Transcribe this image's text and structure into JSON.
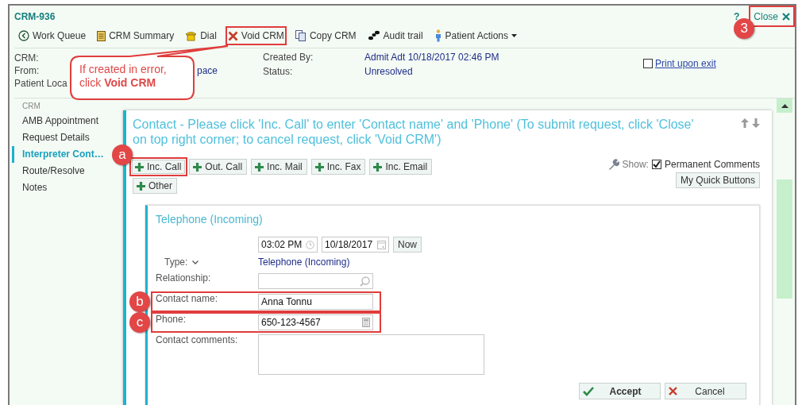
{
  "window": {
    "title": "CRM-936",
    "help": "?",
    "close": {
      "label": "Close",
      "highlighted": true,
      "marker": "3"
    }
  },
  "toolbar": [
    {
      "label": "Work Queue",
      "highlighted": false
    },
    {
      "label": "CRM Summary",
      "highlighted": false
    },
    {
      "label": "Dial",
      "highlighted": false
    },
    {
      "label": "Void CRM",
      "highlighted": true
    },
    {
      "label": "Copy CRM",
      "highlighted": false
    },
    {
      "label": "Audit trail",
      "highlighted": false
    },
    {
      "label": "Patient Actions",
      "highlighted": false,
      "dropdown": true
    }
  ],
  "callout": "If created in error, click **Void CRM**",
  "info": {
    "left": [
      {
        "label": "CRM:"
      },
      {
        "label": "From:",
        "value": "pace"
      },
      {
        "label": "Patient Loca"
      }
    ],
    "middle": [
      {
        "label": "Created By:",
        "value": "Admit Adt 10/18/2017 02:46 PM"
      },
      {
        "label": "Status:",
        "value": "Unresolved"
      }
    ],
    "print": {
      "label": "Print upon exit",
      "checked": false
    }
  },
  "sidebar": {
    "header": "CRM",
    "items": [
      {
        "label": "AMB Appointment",
        "selected": false
      },
      {
        "label": "Request Details",
        "selected": false
      },
      {
        "label": "Interpreter Cont…",
        "selected": true
      },
      {
        "label": "Route/Resolve",
        "selected": false
      },
      {
        "label": "Notes",
        "selected": false
      }
    ]
  },
  "panel": {
    "title": "Contact - Please click 'Inc. Call' to enter 'Contact name' and 'Phone' (To submit request, click 'Close' on top right corner; to cancel request, click 'Void CRM')",
    "quick_buttons": [
      {
        "label": "Inc. Call",
        "highlighted": true,
        "marker": "a"
      },
      {
        "label": "Out. Call",
        "highlighted": false
      },
      {
        "label": "Inc. Mail",
        "highlighted": false
      },
      {
        "label": "Inc. Fax",
        "highlighted": false
      },
      {
        "label": "Inc. Email",
        "highlighted": false
      },
      {
        "label": "Other",
        "highlighted": false
      }
    ],
    "show_label": "Show:",
    "permanent_comments": {
      "label": "Permanent Comments",
      "checked": true
    },
    "my_quick_buttons": "My Quick Buttons"
  },
  "contact": {
    "title": "Telephone (Incoming)",
    "time": "03:02 PM",
    "date": "10/18/2017",
    "now": "Now",
    "type_label": "Type:",
    "type_value": "Telephone (Incoming)",
    "fields": [
      {
        "kind": "lookup",
        "label": "Relationship:",
        "highlighted": false
      },
      {
        "kind": "text",
        "label": "Contact name:",
        "value": "Anna Tonnu",
        "highlighted": true,
        "marker": "b"
      },
      {
        "kind": "phone",
        "label": "Phone:",
        "value": "650-123-4567",
        "highlighted": true,
        "marker": "c"
      },
      {
        "kind": "textarea",
        "label": "Contact comments:",
        "highlighted": false
      }
    ],
    "actions": [
      {
        "label": "Accept",
        "kind": "accept"
      },
      {
        "label": "Cancel",
        "kind": "cancel"
      }
    ]
  }
}
